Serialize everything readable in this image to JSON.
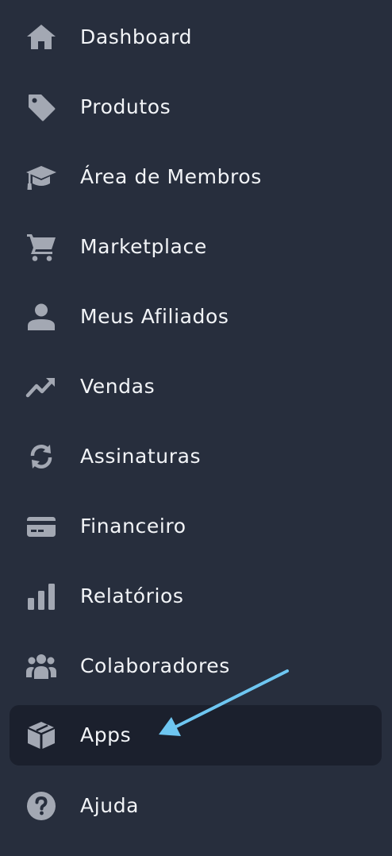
{
  "sidebar": {
    "items": [
      {
        "label": "Dashboard",
        "icon": "home-icon"
      },
      {
        "label": "Produtos",
        "icon": "tag-icon"
      },
      {
        "label": "Área de Membros",
        "icon": "graduation-cap-icon"
      },
      {
        "label": "Marketplace",
        "icon": "shopping-cart-icon"
      },
      {
        "label": "Meus Afiliados",
        "icon": "user-icon"
      },
      {
        "label": "Vendas",
        "icon": "trending-up-icon"
      },
      {
        "label": "Assinaturas",
        "icon": "refresh-icon"
      },
      {
        "label": "Financeiro",
        "icon": "credit-card-icon"
      },
      {
        "label": "Relatórios",
        "icon": "bar-chart-icon"
      },
      {
        "label": "Colaboradores",
        "icon": "users-group-icon"
      },
      {
        "label": "Apps",
        "icon": "cube-icon",
        "active": true
      },
      {
        "label": "Ajuda",
        "icon": "help-circle-icon"
      }
    ]
  },
  "colors": {
    "background": "#272e3d",
    "active_background": "#1b202d",
    "icon": "#a3a8b3",
    "text": "#f2f4f7",
    "arrow": "#6ec6f1"
  }
}
